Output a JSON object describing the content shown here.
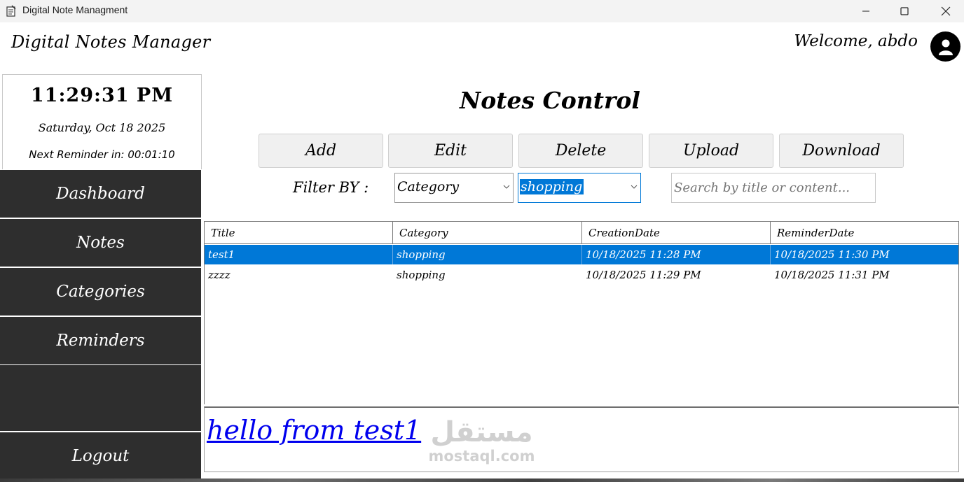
{
  "window": {
    "title": "Digital Note Managment",
    "icon": "notepad-icon",
    "controls": [
      "minimize-icon",
      "maximize-icon",
      "close-icon"
    ]
  },
  "header": {
    "app_name": "Digital Notes Manager",
    "welcome": "Welcome, abdo",
    "avatar_icon": "user-icon"
  },
  "clock": {
    "time": "11:29:31 PM",
    "date": "Saturday, Oct 18 2025",
    "reminder": "Next Reminder in: 00:01:10"
  },
  "sidebar": {
    "items": [
      {
        "label": "Dashboard"
      },
      {
        "label": "Notes"
      },
      {
        "label": "Categories"
      },
      {
        "label": "Reminders"
      },
      {
        "label": ""
      }
    ],
    "logout": "Logout"
  },
  "main": {
    "title": "Notes Control",
    "actions": [
      "Add",
      "Edit",
      "Delete",
      "Upload",
      "Download"
    ],
    "filter": {
      "label": "Filter BY :",
      "field": "Category",
      "value": "shopping",
      "search_placeholder": "Search by title or content..."
    },
    "table": {
      "columns": [
        "Title",
        "Category",
        "CreationDate",
        "ReminderDate"
      ],
      "rows": [
        [
          "test1",
          "shopping",
          "10/18/2025 11:28 PM",
          "10/18/2025 11:30 PM"
        ],
        [
          "zzzz",
          "shopping",
          "10/18/2025 11:29 PM",
          "10/18/2025 11:31 PM"
        ]
      ],
      "selected_row": 0
    },
    "content": "hello from test1"
  },
  "watermark": {
    "arabic": "مستقل",
    "latin": "mostaql.com"
  },
  "colors": {
    "sidebar_bg": "#2e2e2e",
    "selection": "#0078d7",
    "link": "#0000ee"
  }
}
